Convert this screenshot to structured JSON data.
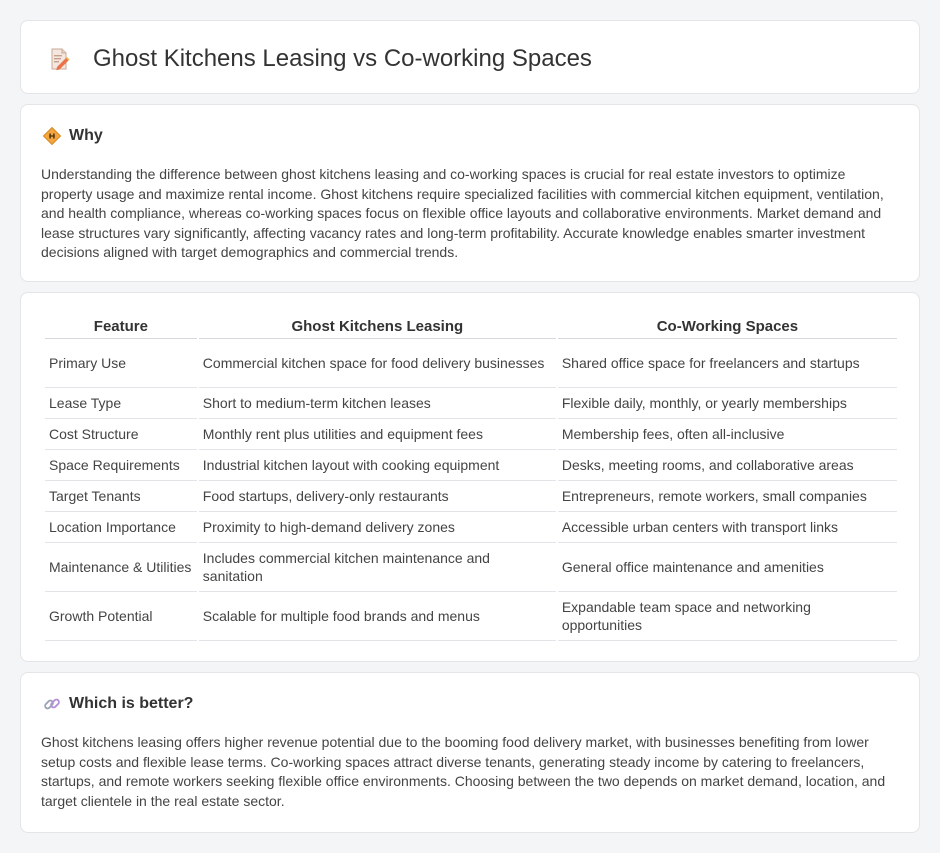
{
  "header": {
    "title": "Ghost Kitchens Leasing vs Co-working Spaces",
    "icon": "memo-pencil-icon"
  },
  "why": {
    "heading": "Why",
    "icon": "diamond-sign-icon",
    "text": "Understanding the difference between ghost kitchens leasing and co-working spaces is crucial for real estate investors to optimize property usage and maximize rental income. Ghost kitchens require specialized facilities with commercial kitchen equipment, ventilation, and health compliance, whereas co-working spaces focus on flexible office layouts and collaborative environments. Market demand and lease structures vary significantly, affecting vacancy rates and long-term profitability. Accurate knowledge enables smarter investment decisions aligned with target demographics and commercial trends."
  },
  "table": {
    "headers": [
      "Feature",
      "Ghost Kitchens Leasing",
      "Co-Working Spaces"
    ],
    "rows": [
      [
        "Primary Use",
        "Commercial kitchen space for food delivery businesses",
        "Shared office space for freelancers and startups"
      ],
      [
        "Lease Type",
        "Short to medium-term kitchen leases",
        "Flexible daily, monthly, or yearly memberships"
      ],
      [
        "Cost Structure",
        "Monthly rent plus utilities and equipment fees",
        "Membership fees, often all-inclusive"
      ],
      [
        "Space Requirements",
        "Industrial kitchen layout with cooking equipment",
        "Desks, meeting rooms, and collaborative areas"
      ],
      [
        "Target Tenants",
        "Food startups, delivery-only restaurants",
        "Entrepreneurs, remote workers, small companies"
      ],
      [
        "Location Importance",
        "Proximity to high-demand delivery zones",
        "Accessible urban centers with transport links"
      ],
      [
        "Maintenance & Utilities",
        "Includes commercial kitchen maintenance and sanitation",
        "General office maintenance and amenities"
      ],
      [
        "Growth Potential",
        "Scalable for multiple food brands and menus",
        "Expandable team space and networking opportunities"
      ]
    ]
  },
  "better": {
    "heading": "Which is better?",
    "icon": "link-icon",
    "text": "Ghost kitchens leasing offers higher revenue potential due to the booming food delivery market, with businesses benefiting from lower setup costs and flexible lease terms. Co-working spaces attract diverse tenants, generating steady income by catering to freelancers, startups, and remote workers seeking flexible office environments. Choosing between the two depends on market demand, location, and target clientele in the real estate sector."
  }
}
